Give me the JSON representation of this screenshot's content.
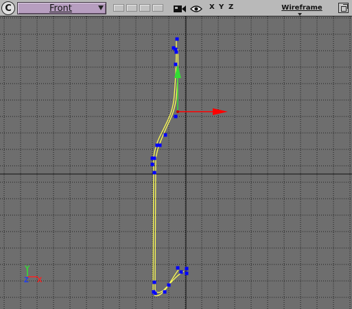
{
  "toolbar": {
    "menu_icon": "C",
    "view_name": "Front",
    "axis_toggles": [
      "X",
      "Y",
      "Z"
    ],
    "shading_mode": "Wireframe"
  },
  "viewport": {
    "background_color": "#6e6e6e",
    "grid_color": "#1e1e1e",
    "axis_line_color": "#101010",
    "spline_color": "#ffff55",
    "vertex_color": "#0000ff",
    "gizmo_x_color": "#ff0000",
    "gizmo_y_color": "#33dd33"
  },
  "axis_tripod": {
    "y_label": "Y",
    "z_label": "Z",
    "x_label": "X",
    "y_color": "#33dd33",
    "z_color": "#1a3bff",
    "x_color": "#ff2020"
  }
}
